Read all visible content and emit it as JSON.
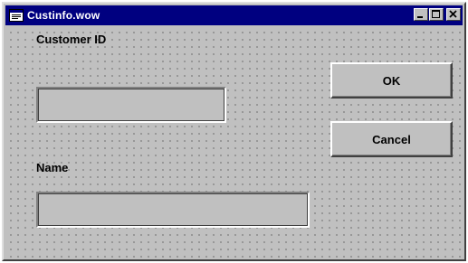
{
  "window": {
    "title": "Custinfo.wow",
    "icon": "window-app-icon"
  },
  "title_buttons": {
    "minimize": "minimize-icon",
    "maximize": "maximize-icon",
    "close": "close-icon"
  },
  "form": {
    "customer_id_label": "Customer ID",
    "customer_id_value": "",
    "name_label": "Name",
    "name_value": ""
  },
  "buttons": {
    "ok_label": "OK",
    "cancel_label": "Cancel"
  },
  "colors": {
    "titlebar": "#000080",
    "face": "#c0c0c0",
    "grid_dots": "#8c8c8c"
  }
}
